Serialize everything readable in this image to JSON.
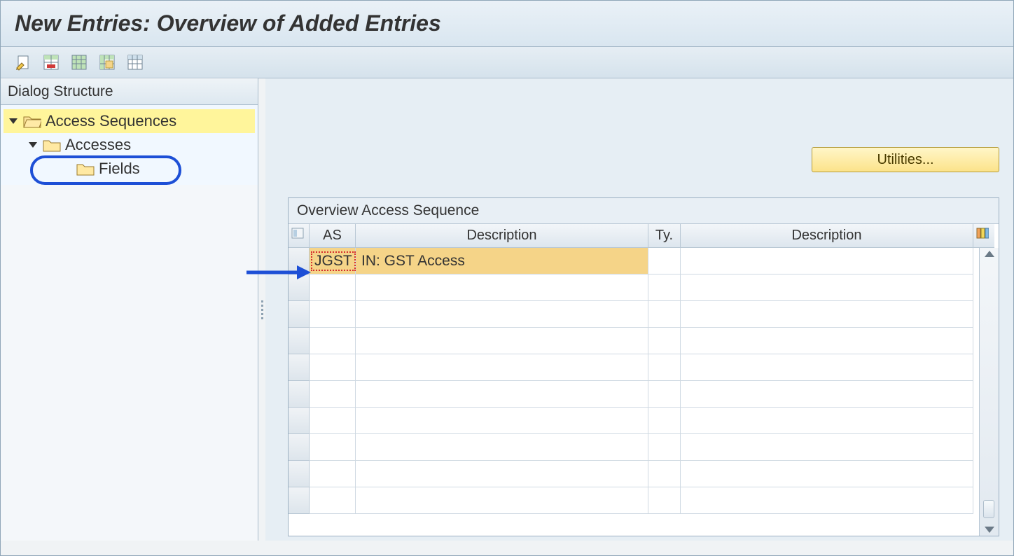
{
  "title": "New Entries: Overview of Added Entries",
  "toolbar": {
    "btn1": "change-doc-icon",
    "btn2": "delete-row-icon",
    "btn3": "select-all-icon",
    "btn4": "select-block-icon",
    "btn5": "deselect-all-icon"
  },
  "dialogStructure": {
    "header": "Dialog Structure",
    "nodes": {
      "root": {
        "label": "Access Sequences",
        "expanded": true,
        "selected": true
      },
      "child1": {
        "label": "Accesses",
        "expanded": true,
        "highlighted": true
      },
      "child2": {
        "label": "Fields",
        "expanded": false
      }
    }
  },
  "rightPanel": {
    "utilitiesLabel": "Utilities...",
    "tableTitle": "Overview Access Sequence",
    "columns": {
      "sel": "",
      "as": "AS",
      "desc1": "Description",
      "ty": "Ty.",
      "desc2": "Description"
    },
    "rows": [
      {
        "as": "JGST",
        "desc1": "IN: GST Access",
        "ty": "",
        "desc2": ""
      },
      {
        "as": "",
        "desc1": "",
        "ty": "",
        "desc2": ""
      },
      {
        "as": "",
        "desc1": "",
        "ty": "",
        "desc2": ""
      },
      {
        "as": "",
        "desc1": "",
        "ty": "",
        "desc2": ""
      },
      {
        "as": "",
        "desc1": "",
        "ty": "",
        "desc2": ""
      },
      {
        "as": "",
        "desc1": "",
        "ty": "",
        "desc2": ""
      },
      {
        "as": "",
        "desc1": "",
        "ty": "",
        "desc2": ""
      },
      {
        "as": "",
        "desc1": "",
        "ty": "",
        "desc2": ""
      },
      {
        "as": "",
        "desc1": "",
        "ty": "",
        "desc2": ""
      },
      {
        "as": "",
        "desc1": "",
        "ty": "",
        "desc2": ""
      }
    ]
  }
}
